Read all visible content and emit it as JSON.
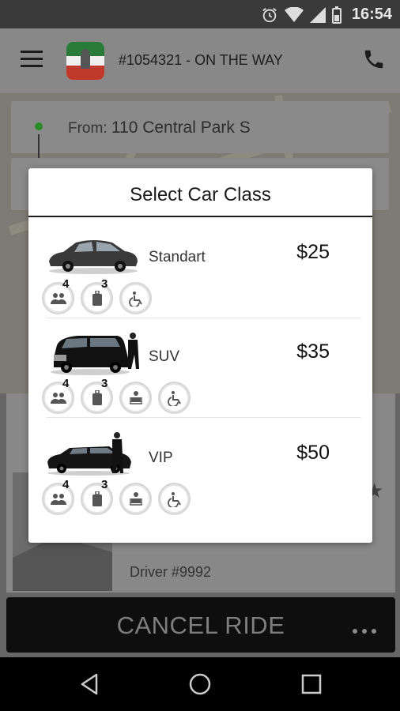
{
  "status_bar": {
    "time": "16:54"
  },
  "toolbar": {
    "title": "#1054321 - ON THE WAY"
  },
  "route": {
    "from_label": "From:",
    "from_value": "110 Central Park S"
  },
  "driver": {
    "label": "Driver #9992"
  },
  "cancel_button": {
    "label": "CANCEL RIDE"
  },
  "dialog": {
    "title": "Select Car Class",
    "cars": [
      {
        "name": "Standart",
        "price": "$25",
        "features": [
          {
            "icon": "passengers-icon",
            "count": "4"
          },
          {
            "icon": "luggage-icon",
            "count": "3"
          },
          {
            "icon": "wheelchair-icon",
            "count": ""
          }
        ]
      },
      {
        "name": "SUV",
        "price": "$35",
        "features": [
          {
            "icon": "passengers-icon",
            "count": "4"
          },
          {
            "icon": "luggage-icon",
            "count": "3"
          },
          {
            "icon": "child-seat-icon",
            "count": ""
          },
          {
            "icon": "wheelchair-icon",
            "count": ""
          }
        ]
      },
      {
        "name": "VIP",
        "price": "$50",
        "features": [
          {
            "icon": "passengers-icon",
            "count": "4"
          },
          {
            "icon": "luggage-icon",
            "count": "3"
          },
          {
            "icon": "child-seat-icon",
            "count": ""
          },
          {
            "icon": "wheelchair-icon",
            "count": ""
          }
        ]
      }
    ]
  },
  "colors": {
    "overlay": "#7a7a7a",
    "dialog_bg": "#ffffff",
    "cancel_bg": "#0e0e0e",
    "from_dot": "#2a8a2a"
  }
}
